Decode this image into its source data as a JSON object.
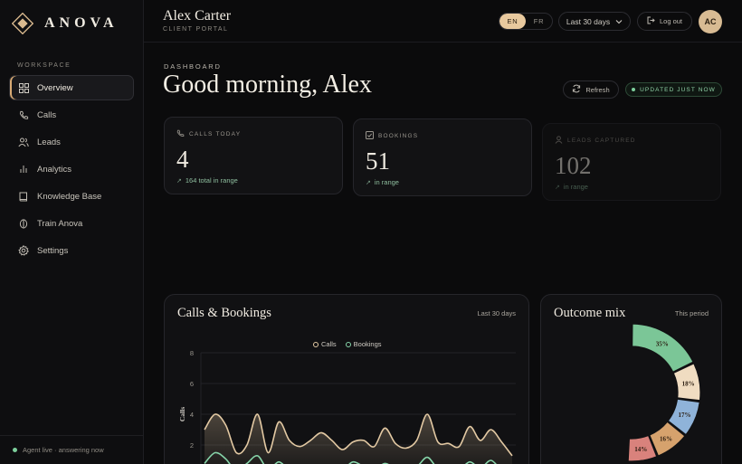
{
  "brand": {
    "name": "ANOVA"
  },
  "sidebar": {
    "section": "WORKSPACE",
    "items": [
      {
        "label": "Overview",
        "icon": "grid-icon",
        "active": true
      },
      {
        "label": "Calls",
        "icon": "phone-icon"
      },
      {
        "label": "Leads",
        "icon": "users-icon"
      },
      {
        "label": "Analytics",
        "icon": "bar-chart-icon"
      },
      {
        "label": "Knowledge Base",
        "icon": "book-icon"
      },
      {
        "label": "Train Anova",
        "icon": "brain-icon"
      },
      {
        "label": "Settings",
        "icon": "gear-icon"
      }
    ],
    "footer": "Agent live · answering now"
  },
  "header": {
    "user_name": "Alex Carter",
    "user_role": "CLIENT PORTAL",
    "lang": [
      "EN",
      "FR"
    ],
    "lang_selected": "EN",
    "range": "Last 30 days",
    "logout": "Log out",
    "avatar": "AC"
  },
  "main": {
    "kicker": "DASHBOARD",
    "greeting": "Good morning, Alex",
    "refresh": "Refresh",
    "status": "UPDATED JUST NOW"
  },
  "stats": [
    {
      "label": "CALLS TODAY",
      "value": "4",
      "sub": "164 total in range",
      "icon": "phone-icon"
    },
    {
      "label": "BOOKINGS",
      "value": "51",
      "sub": "in range",
      "icon": "checkbox-icon"
    },
    {
      "label": "LEADS CAPTURED",
      "value": "102",
      "sub": "in range",
      "icon": "user-icon"
    }
  ],
  "colors": {
    "accent": "#e8c99e",
    "calls": "#e3c9a3",
    "bookings": "#86d4a9",
    "live": "#7dcf9c"
  },
  "chart_data": [
    {
      "type": "area",
      "title": "Calls & Bookings",
      "meta": "Last 30 days",
      "ylabel": "Calls",
      "yticks": [
        2,
        4,
        6,
        8
      ],
      "ylim": [
        0,
        8
      ],
      "series": [
        {
          "name": "Calls",
          "values": [
            3,
            4,
            3.3,
            1.5,
            2,
            4,
            1.5,
            3.5,
            2.3,
            1.9,
            2.3,
            2.8,
            2.3,
            1.7,
            2.2,
            2.3,
            1.9,
            3.1,
            2.1,
            1.8,
            2.3,
            4,
            2.2,
            2.1,
            1.9,
            3.2,
            2.3,
            3,
            2.2,
            1.3
          ]
        },
        {
          "name": "Bookings",
          "values": [
            0.8,
            1.5,
            1.1,
            0.3,
            0.8,
            1.3,
            0.4,
            0.9,
            0.4,
            0.6,
            0.6,
            0.3,
            0.6,
            0.4,
            0.9,
            0.6,
            0.4,
            0.8,
            0.5,
            0.6,
            0.6,
            1.2,
            0.5,
            0.7,
            0.4,
            0.9,
            0.5,
            1.0,
            0.4,
            0.5
          ]
        }
      ]
    },
    {
      "type": "pie",
      "title": "Outcome mix",
      "meta": "This period",
      "slices": [
        {
          "label": "35%",
          "value": 35,
          "color": "#7bc697"
        },
        {
          "label": "18%",
          "value": 18,
          "color": "#f0dcc1"
        },
        {
          "label": "17%",
          "value": 17,
          "color": "#8fb3d9"
        },
        {
          "label": "16%",
          "value": 16,
          "color": "#d6a26d"
        },
        {
          "label": "14%",
          "value": 14,
          "color": "#d9827c"
        }
      ]
    }
  ]
}
